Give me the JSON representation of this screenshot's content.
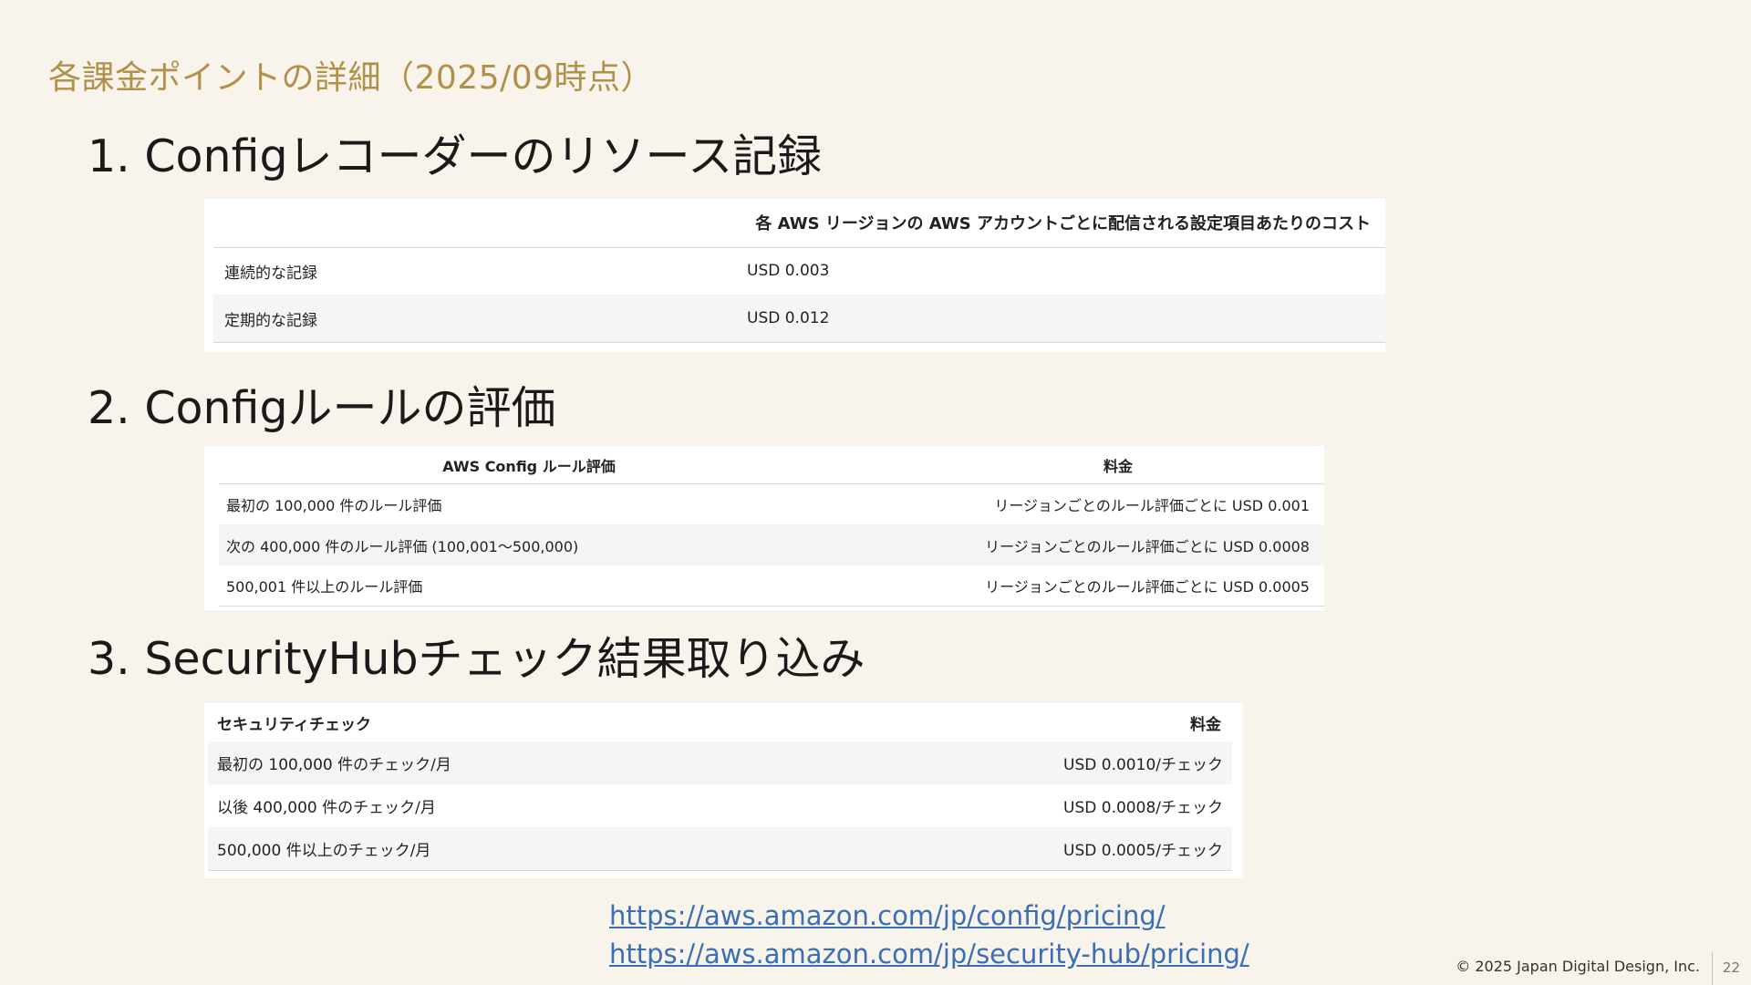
{
  "slide": {
    "title": "各課金ポイントの詳細（2025/09時点）",
    "page_number": "22",
    "copyright": "© 2025 Japan Digital Design, Inc."
  },
  "sections": [
    {
      "heading": "1. Configレコーダーのリソース記録",
      "table": {
        "header": [
          "",
          "各 AWS リージョンの AWS アカウントごとに配信される設定項目あたりのコスト"
        ],
        "rows": [
          [
            "連続的な記録",
            "USD 0.003"
          ],
          [
            "定期的な記録",
            "USD 0.012"
          ]
        ]
      }
    },
    {
      "heading": "2. Configルールの評価",
      "table": {
        "header": [
          "AWS Config ルール評価",
          "料金"
        ],
        "rows": [
          [
            "最初の 100,000 件のルール評価",
            "リージョンごとのルール評価ごとに USD 0.001"
          ],
          [
            "次の 400,000 件のルール評価 (100,001〜500,000)",
            "リージョンごとのルール評価ごとに USD 0.0008"
          ],
          [
            "500,001 件以上のルール評価",
            "リージョンごとのルール評価ごとに USD 0.0005"
          ]
        ]
      }
    },
    {
      "heading": "3. SecurityHubチェック結果取り込み",
      "table": {
        "header": [
          "セキュリティチェック",
          "料金"
        ],
        "rows": [
          [
            "最初の 100,000 件のチェック/月",
            "USD 0.0010/チェック"
          ],
          [
            "以後 400,000 件のチェック/月",
            "USD 0.0008/チェック"
          ],
          [
            "500,000 件以上のチェック/月",
            "USD 0.0005/チェック"
          ]
        ]
      }
    }
  ],
  "links": [
    "https://aws.amazon.com/jp/config/pricing/",
    "https://aws.amazon.com/jp/security-hub/pricing/"
  ]
}
